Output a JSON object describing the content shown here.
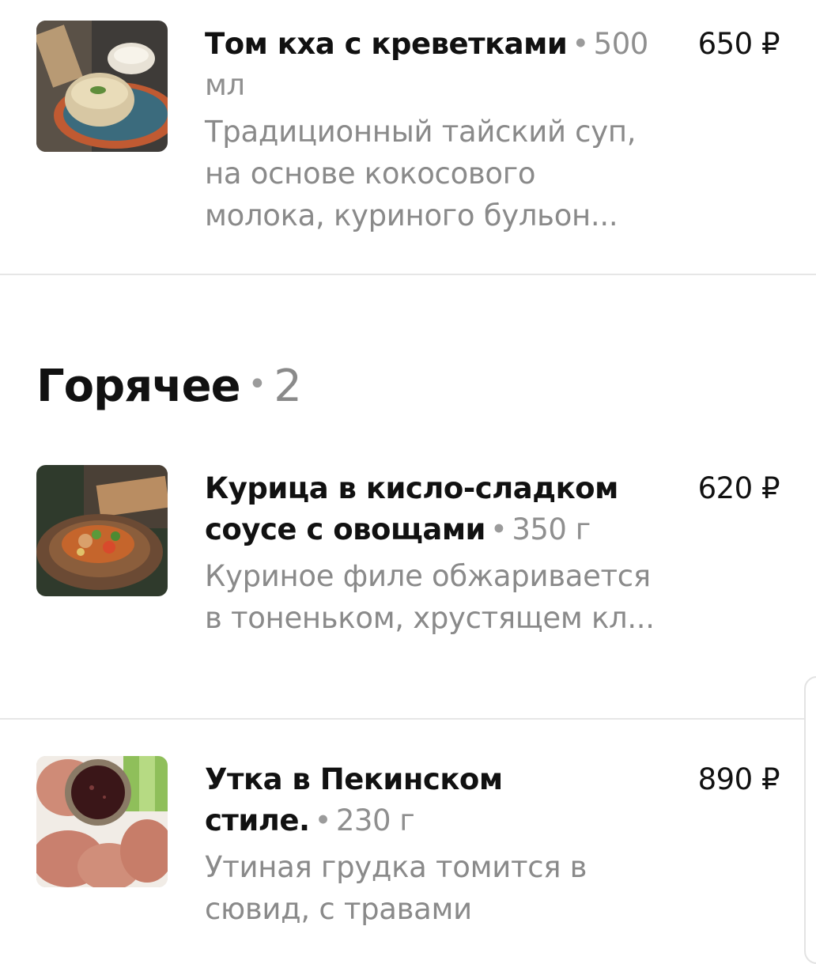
{
  "items_top": [
    {
      "name": "Том кха с креветками",
      "weight": "500 мл",
      "price": "650 ₽",
      "description": "Традиционный тайский суп, на основе кокосового молока, куриного бульон..."
    }
  ],
  "section": {
    "title": "Горячее",
    "count": "2"
  },
  "items_hot": [
    {
      "name": "Курица в кисло-сладком соусе с овощами",
      "weight": "350 г",
      "price": "620 ₽",
      "description": "Куриное филе обжаривается в тоненьком, хрустящем кл..."
    },
    {
      "name": "Утка в Пекинском стиле.",
      "weight": "230 г",
      "price": "890 ₽",
      "description": "Утиная грудка томится в сювид, с травами"
    }
  ],
  "separator_dot": "•",
  "icons": {
    "item1": "soup-photo",
    "item2": "chicken-dish-photo",
    "item3": "duck-dish-photo"
  }
}
